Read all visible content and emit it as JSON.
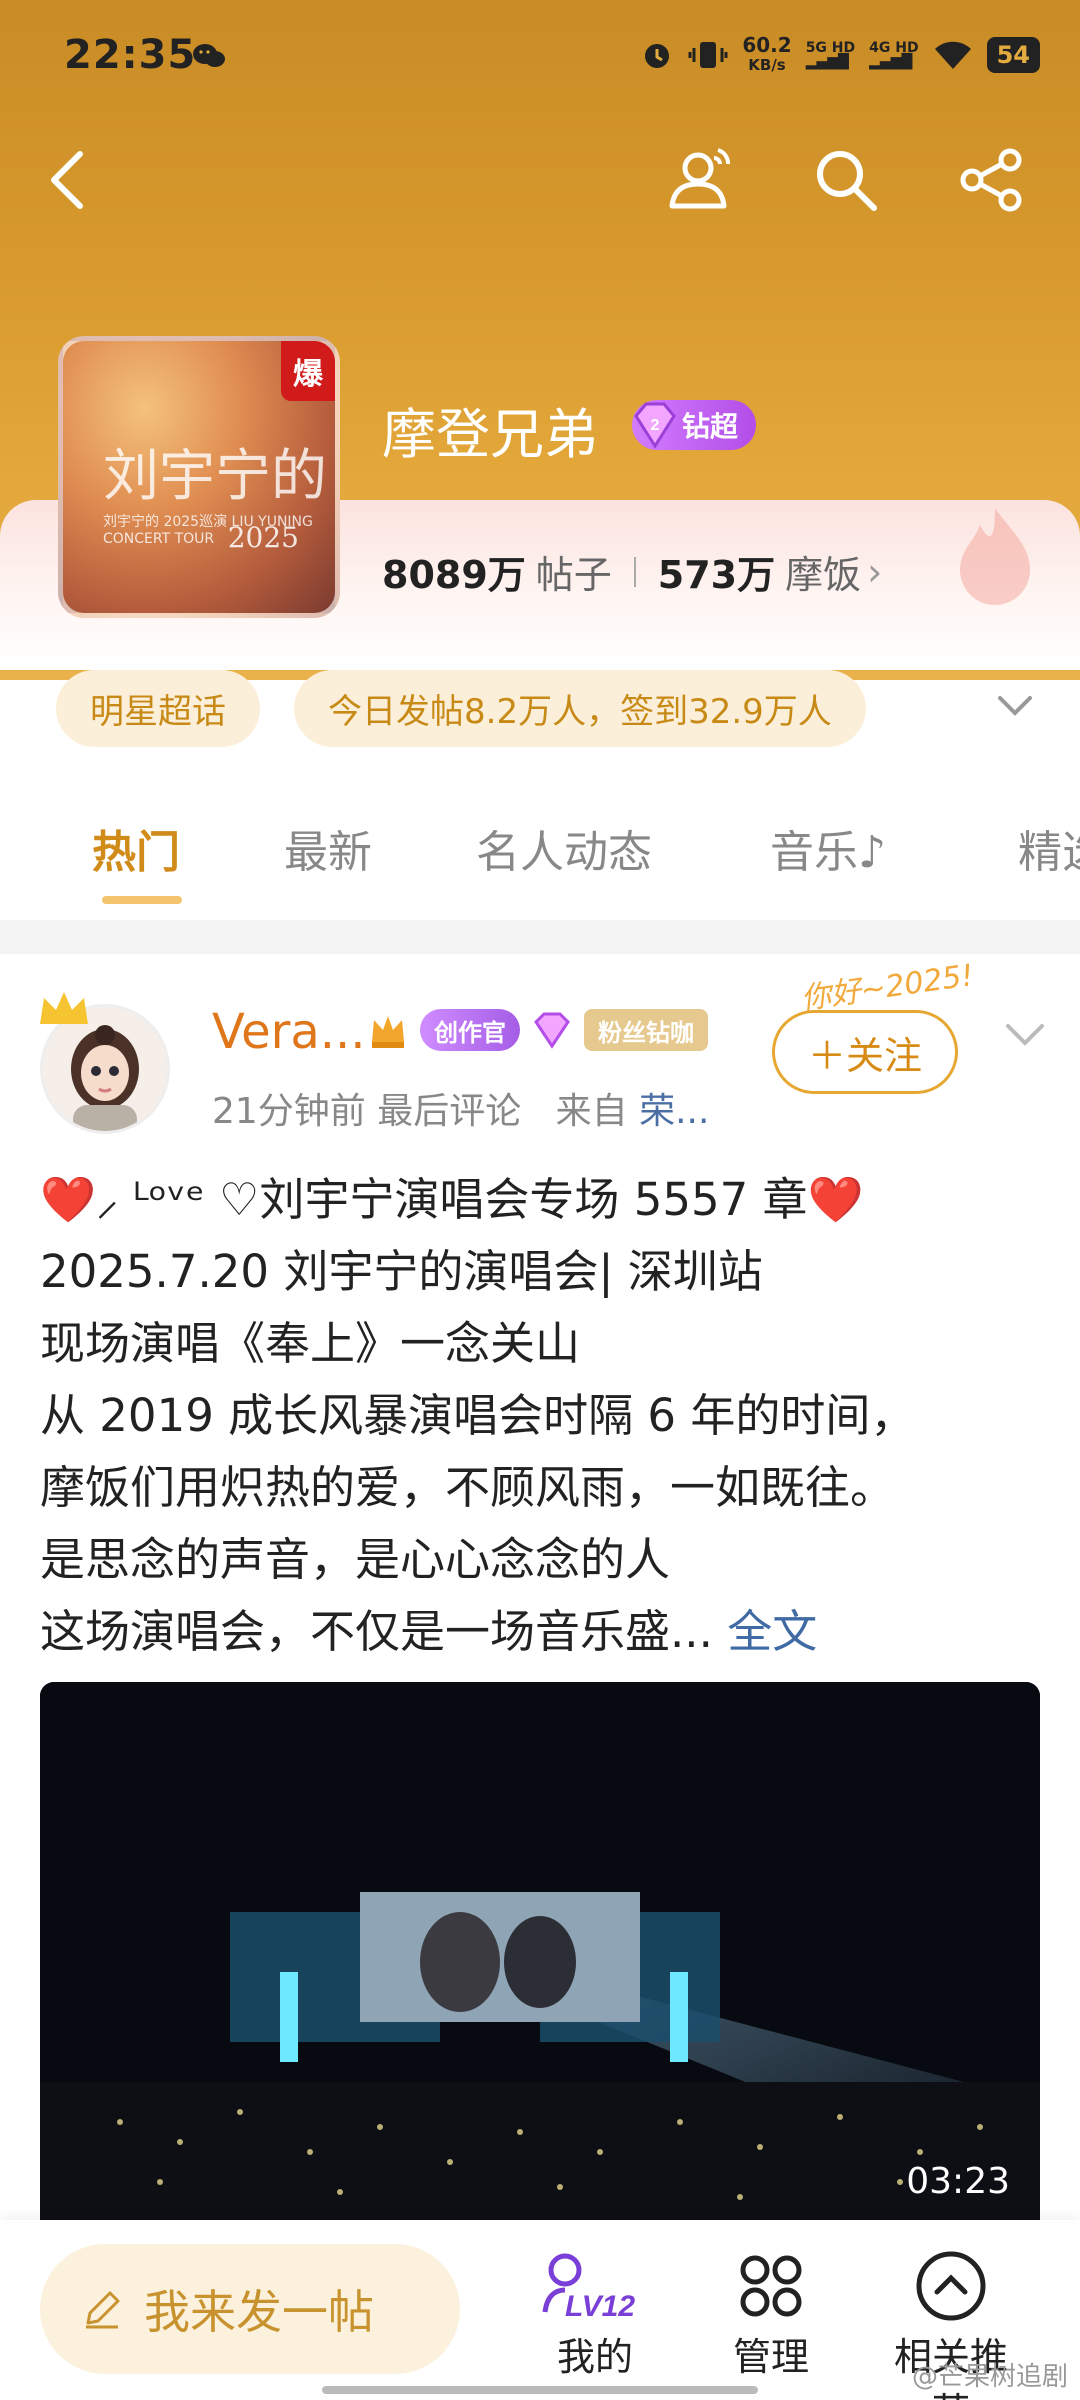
{
  "status_bar": {
    "time": "22:35",
    "net_speed": "60.2",
    "net_unit": "KB/s",
    "signal1": "5G HD",
    "signal2": "4G HD",
    "battery": "54"
  },
  "topic": {
    "name": "摩登兄弟",
    "tier": "钻超",
    "posts_count": "8089万",
    "posts_label": "帖子",
    "fans_count": "573万",
    "fans_label": "摩饭",
    "cover_title": "刘宇宁的",
    "cover_year": "2025",
    "cover_sub": "刘宇宁的 2025巡演 LIU YUNING CONCERT TOUR",
    "hot_badge": "爆"
  },
  "chips": [
    "明星超话",
    "今日发帖8.2万人，签到32.9万人"
  ],
  "tabs": [
    "热门",
    "最新",
    "名人动态",
    "音乐♪",
    "精选"
  ],
  "post": {
    "username": "Vera...",
    "creator_badge": "创作官",
    "fan_badge": "粉丝钻咖",
    "follow_label": "＋关注",
    "deco_text": "你好~2025!",
    "time": "21分钟前 最后评论",
    "source_prefix": "来自",
    "source": "荣...",
    "lines": [
      "❤️⸝ ᴸᵒᵛᵉ ♡刘宇宁演唱会专场 5557 章❤️",
      "2025.7.20 刘宇宁的演唱会| 深圳站",
      "现场演唱《奉上》一念关山",
      "从 2019 成长风暴演唱会时隔 6 年的时间，",
      "摩饭们用炽热的爱，不顾风雨，一如既往。",
      "是思念的声音，是心心念念的人",
      "这场演唱会，不仅是一场音乐盛..."
    ],
    "full_text_label": "全文",
    "video_duration": "03:23"
  },
  "bottom_bar": {
    "compose_label": "我来发一帖",
    "level": "LV12",
    "mine_label": "我的",
    "manage_label": "管理",
    "related_label": "相关推荐"
  },
  "watermark": "@芒果树追剧",
  "colors": {
    "header": "#d89a2d",
    "accent": "#d08b19",
    "link": "#3f6aa4",
    "username": "#e0761a"
  }
}
